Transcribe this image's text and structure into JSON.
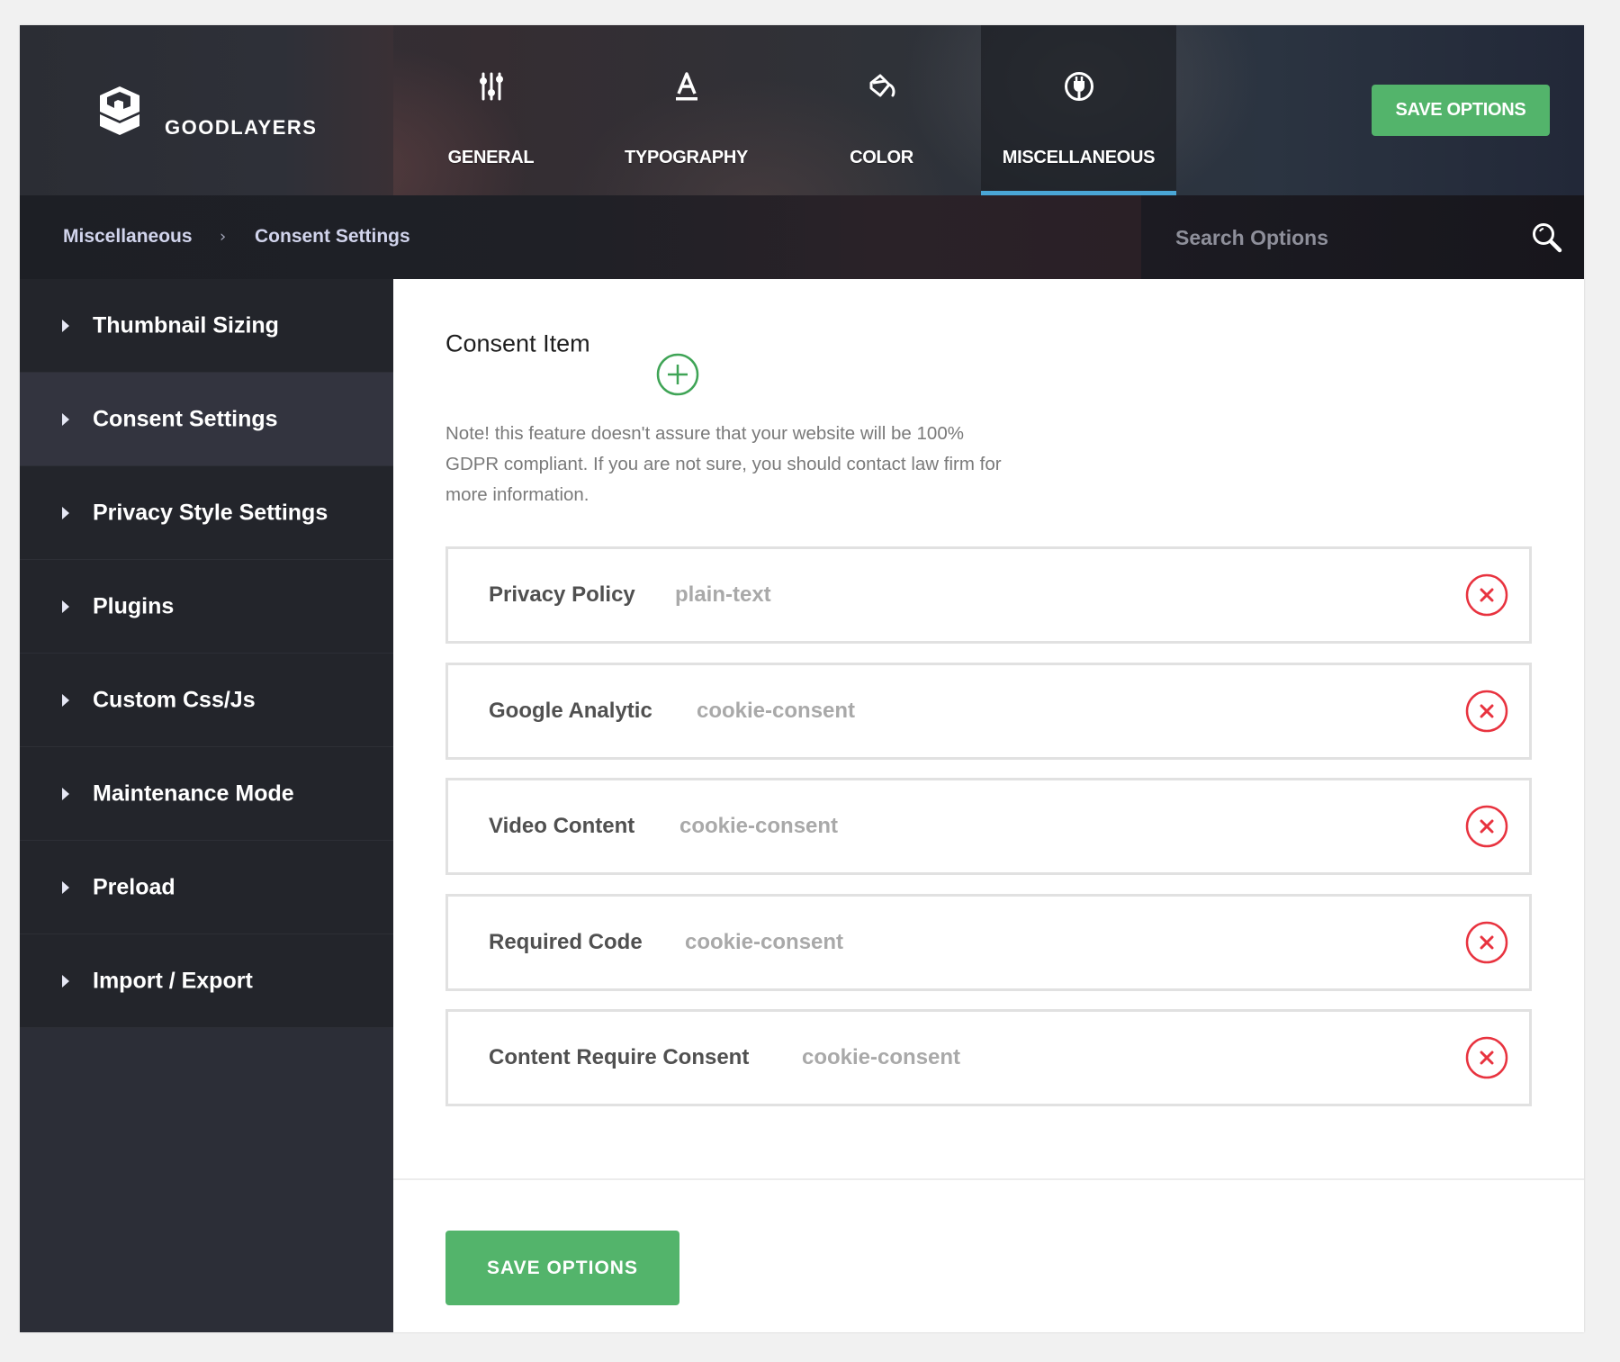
{
  "brand": {
    "name": "GOODLAYERS",
    "icon": "goodlayers-logo-icon"
  },
  "nav": {
    "tabs": [
      {
        "label": "GENERAL",
        "icon": "sliders-icon",
        "active": false
      },
      {
        "label": "TYPOGRAPHY",
        "icon": "text-a-underline-icon",
        "active": false
      },
      {
        "label": "COLOR",
        "icon": "paint-bucket-icon",
        "active": false
      },
      {
        "label": "MISCELLANEOUS",
        "icon": "plug-icon",
        "active": true
      }
    ],
    "save_label": "SAVE OPTIONS",
    "active_color": "#4aa6d6"
  },
  "breadcrumb": {
    "items": [
      "Miscellaneous",
      "Consent Settings"
    ],
    "separator": "›"
  },
  "search": {
    "placeholder": "Search Options",
    "value": "",
    "icon": "search-icon"
  },
  "sidebar": {
    "items": [
      {
        "label": "Thumbnail Sizing",
        "active": false
      },
      {
        "label": "Consent Settings",
        "active": true
      },
      {
        "label": "Privacy Style Settings",
        "active": false
      },
      {
        "label": "Plugins",
        "active": false
      },
      {
        "label": "Custom Css/Js",
        "active": false
      },
      {
        "label": "Maintenance Mode",
        "active": false
      },
      {
        "label": "Preload",
        "active": false
      },
      {
        "label": "Import / Export",
        "active": false
      }
    ]
  },
  "main": {
    "section_title": "Consent Item",
    "add_icon": "plus-circle-icon",
    "note": "Note! this feature doesn't assure that your website will be 100% GDPR compliant. If you are not sure, you should contact law firm for more information.",
    "items": [
      {
        "name": "Privacy Policy",
        "type": "plain-text"
      },
      {
        "name": "Google Analytic",
        "type": "cookie-consent"
      },
      {
        "name": "Video Content",
        "type": "cookie-consent"
      },
      {
        "name": "Required Code",
        "type": "cookie-consent"
      },
      {
        "name": "Content Require Consent",
        "type": "cookie-consent"
      }
    ],
    "remove_icon": "close-circle-icon",
    "save_label": "SAVE OPTIONS"
  },
  "colors": {
    "accent_green": "#53b46b",
    "remove_red": "#e8333f",
    "add_green": "#3fa456",
    "tab_underline": "#4aa6d6"
  }
}
